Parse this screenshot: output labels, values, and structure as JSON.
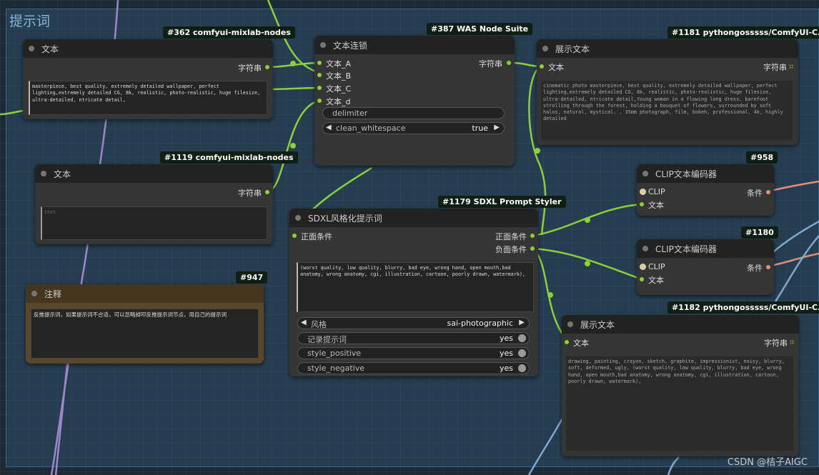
{
  "group": {
    "title": "提示词"
  },
  "nodes": {
    "text1": {
      "badge": "#362 comfyui-mixlab-nodes",
      "title": "文本",
      "output": "字符串",
      "text": "masterpiece, best quality, extremely detailed wallpaper, perfect lighting,extremely detailed CG, 8k, realistic, photo-realistic,  huge filesize, ultra-detailed, ntricate detail,"
    },
    "concat": {
      "badge": "#387 WAS Node Suite",
      "title": "文本连锁",
      "inputs": [
        "文本_A",
        "文本_B",
        "文本_C",
        "文本_d"
      ],
      "output": "字符串",
      "delimiter": "delimiter",
      "clean_label": "clean_whitespace",
      "clean_value": "true"
    },
    "show1": {
      "badge": "#1181 pythongosssss/ComfyUI-C…",
      "title": "展示文本",
      "input": "文本",
      "output": "字符串",
      "text": "cinematic photo masterpiece, best quality, extremely detailed wallpaper, perfect lighting,extremely detailed CG, 8k, realistic, photo-realistic,  huge filesize, ultra-detailed, ntricate detail,Young woman in a flowing long dress, barefoot strolling through the forest, holding a bouquet of flowers, surrounded by soft halos, natural, mystical. . 35mm photograph, film, bokeh, professional, 4k, highly detailed"
    },
    "text2": {
      "badge": "#1119 comfyui-mixlab-nodes",
      "title": "文本",
      "output": "字符串",
      "placeholder": "text"
    },
    "clip1": {
      "badge": "#958",
      "title": "CLIP文本编码器",
      "input_clip": "CLIP",
      "input_text": "文本",
      "output": "条件"
    },
    "clip2": {
      "badge": "#1180",
      "title": "CLIP文本编码器",
      "input_clip": "CLIP",
      "input_text": "文本",
      "output": "条件"
    },
    "styler": {
      "badge": "#1179 SDXL Prompt Styler",
      "title": "SDXL风格化提示词",
      "input": "正面条件",
      "output_pos": "正面条件",
      "output_neg": "负面条件",
      "text": "(worst quality, low quality, blurry, bad eye, wrong hand, open mouth,bad anatomy, wrong anatomy, cgi, illustration, cartoon, poorly drawn, watermark),",
      "style_label": "风格",
      "style_value": "sai-photographic",
      "toggles": [
        {
          "label": "记录提示词",
          "value": "yes"
        },
        {
          "label": "style_positive",
          "value": "yes"
        },
        {
          "label": "style_negative",
          "value": "yes"
        }
      ]
    },
    "note": {
      "badge": "#947",
      "title": "注释",
      "text": "反推提示词，如果提示词不合适，可以忽略掉叩反推提示词节点，用自己的提示词"
    },
    "show2": {
      "badge": "#1182 pythongosssss/ComfyUI-C…",
      "title": "展示文本",
      "input": "文本",
      "output": "字符串",
      "text": "drawing, painting, crayon, sketch, graphite, impressionist, noisy, blurry, soft, deformed, ugly, (worst quality, low quality, blurry, bad eye, wrong hand, open mouth,bad anatomy, wrong anatomy, cgi, illustration, cartoon, poorly drawn, watermark),"
    }
  },
  "watermark": "CSDN @桔子AIGC",
  "colors": {
    "wire_green": "#8ad03a",
    "wire_blue": "#7fa8d0",
    "wire_orange": "#e0907a",
    "wire_purple": "#9a88c8",
    "note_bg": "#4a3a26"
  }
}
